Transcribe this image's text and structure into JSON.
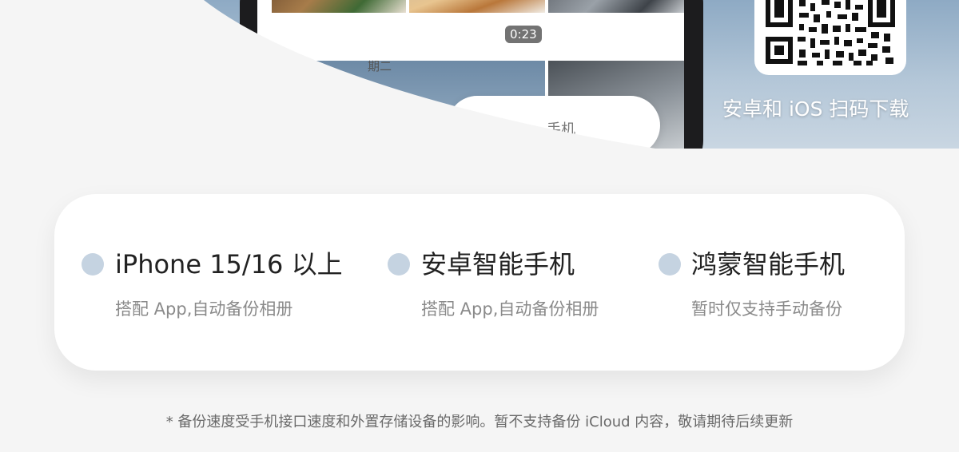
{
  "hero": {
    "video_duration": "0:23",
    "date_fragment": "期二",
    "pill_fragment": "手机",
    "qr_caption": "安卓和 iOS 扫码下载",
    "qr_icon": "qr-code-icon"
  },
  "features": [
    {
      "title": "iPhone 15/16 以上",
      "subtitle": "搭配 App,自动备份相册"
    },
    {
      "title": "安卓智能手机",
      "subtitle": "搭配 App,自动备份相册"
    },
    {
      "title": "鸿蒙智能手机",
      "subtitle": "暂时仅支持手动备份"
    }
  ],
  "footnote": "* 备份速度受手机接口速度和外置存储设备的影响。暂不支持备份 iCloud 内容，敬请期待后续更新",
  "colors": {
    "page_background": "#f5f5f5",
    "card_background": "#ffffff",
    "bullet_dot": "#c5d3e1",
    "title_text": "#222222",
    "subtitle_text": "#8a8a8a"
  }
}
